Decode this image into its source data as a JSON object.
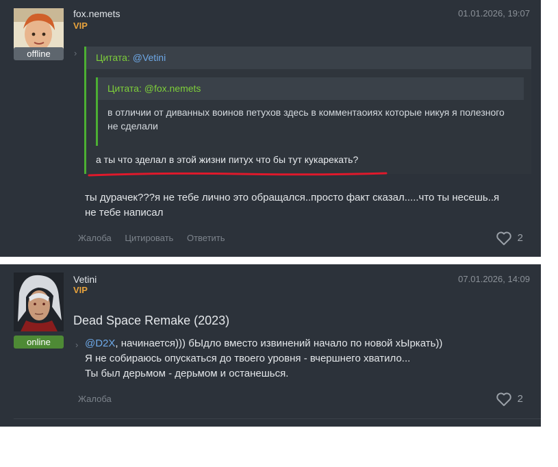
{
  "post1": {
    "author": "fox.nemets",
    "badge": "VIP",
    "date": "01.01.2026, 19:07",
    "status": "offline",
    "quote": {
      "cite_label": "Цитата:",
      "cite_user": "@Vetini",
      "nested": {
        "cite_label": "Цитата:",
        "cite_user": "@fox.nemets",
        "text": "в отличии от диванных воинов петухов здесь в комментаоиях которые никуя я полезного не сделали"
      },
      "text": "а ты что зделал в этой жизни питух что бы тут кукарекать?"
    },
    "body_line1": "ты дурачек???я не тебе лично это обращался..просто факт сказал.....что ты несешь..я",
    "body_line2": "не тебе написал",
    "actions": [
      "Жалоба",
      "Цитировать",
      "Ответить"
    ],
    "likes": "2"
  },
  "post2": {
    "author": "Vetini",
    "badge": "VIP",
    "date": "07.01.2026, 14:09",
    "status": "online",
    "topic": "Dead Space Remake (2023)",
    "mention": "@D2X",
    "line1_rest": ", начинается))) бЫдло вместо извинений начало по новой хЫркать))",
    "line2": "Я не собираюсь опускаться до твоего уровня - вчершнего хватило...",
    "line3": "Ты был дерьмом - дерьмом и останешься.",
    "actions": [
      "Жалоба"
    ],
    "likes": "2"
  },
  "colors": {
    "panel": "#2c323a",
    "vip": "#e8a33c",
    "quote_border": "#4caf33",
    "link": "#6ea9e8",
    "underline": "#e0192b"
  }
}
